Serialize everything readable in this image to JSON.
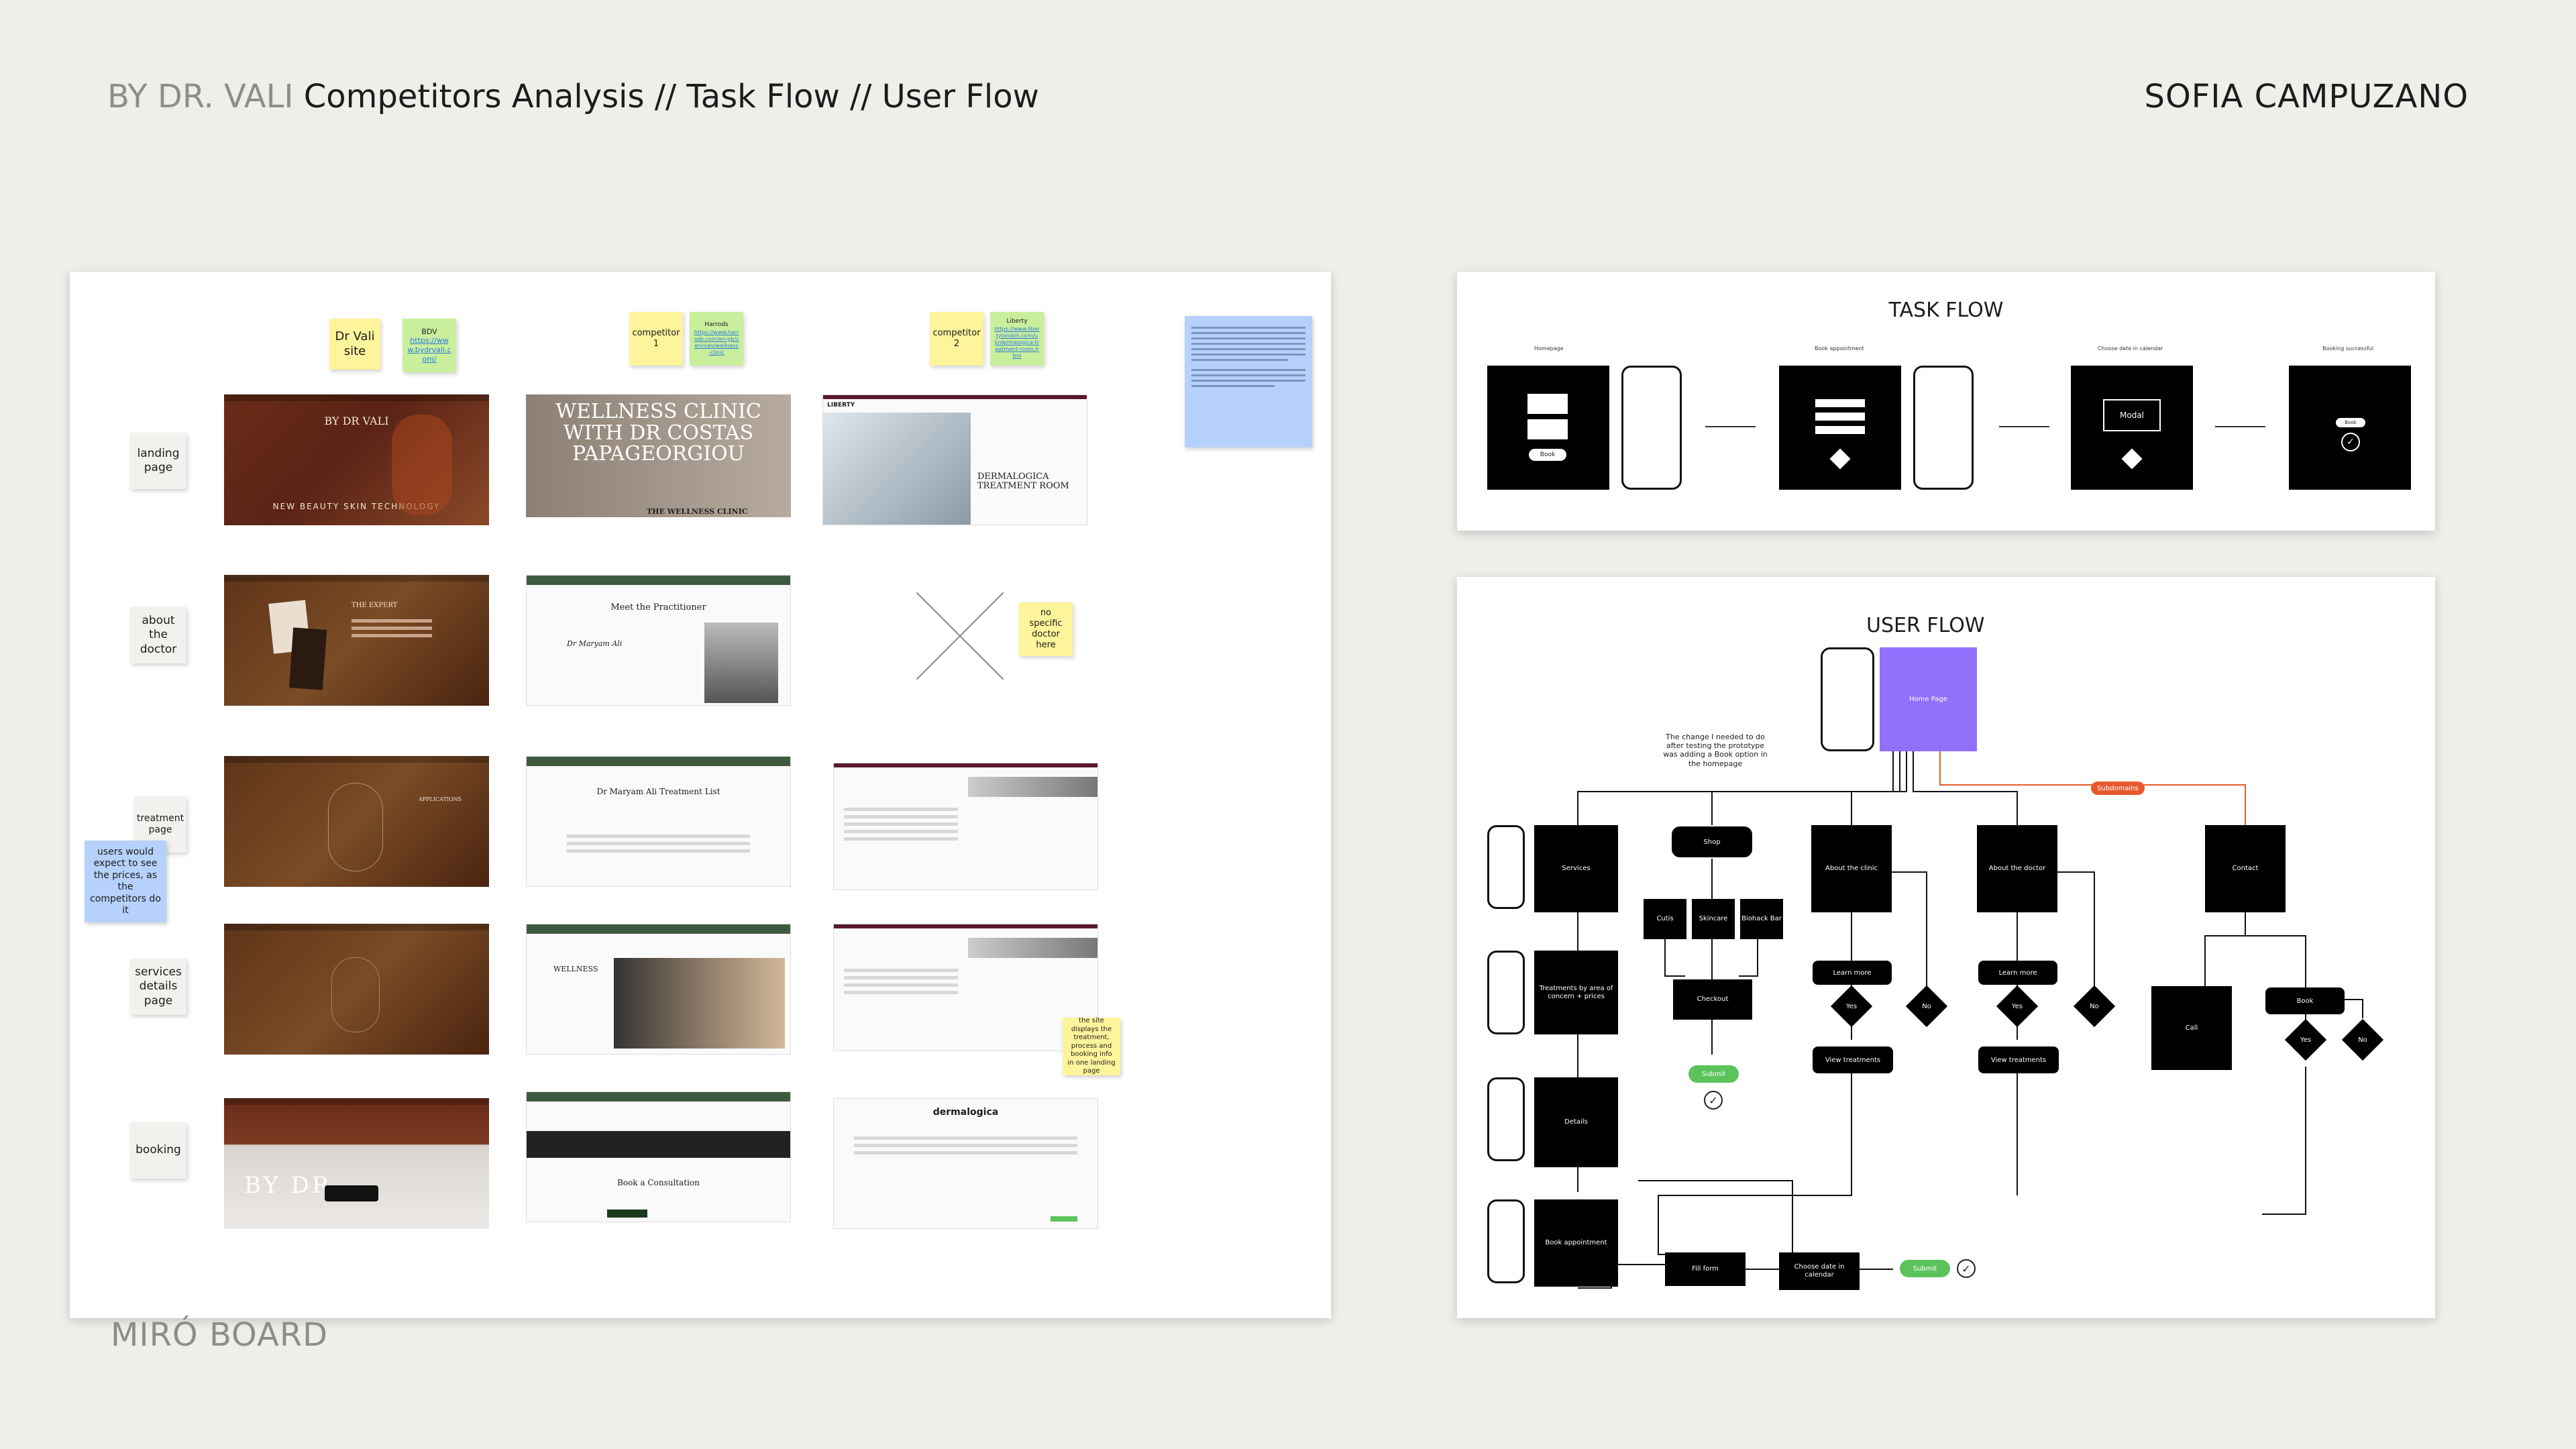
{
  "header": {
    "brand": "BY DR. VALI",
    "title": "Competitors Analysis // Task Flow // User Flow",
    "author": "SOFIA CAMPUZANO"
  },
  "board_label": "MIRÓ BOARD",
  "miro": {
    "columns": [
      {
        "sticky": "Dr Vali site",
        "link_label": "BDV",
        "link": "https://www.bydrvali.com/"
      },
      {
        "sticky": "competitor 1",
        "link_label": "Harrods",
        "link": "https://www.harrods.com/en-gb/services/wellness-clinic"
      },
      {
        "sticky": "competitor 2",
        "link_label": "Liberty",
        "link": "https://www.libertylondon.com/uk/dermalogica-treatment-room.html"
      }
    ],
    "row_labels": [
      "landing page",
      "about the doctor",
      "treatment page",
      "services details page",
      "booking"
    ],
    "notes": {
      "users_expect": "users would expect to see the prices, as the competitors do it",
      "no_doctor": "no specific doctor here",
      "site_displays": "the site displays the treatment, process and booking info in one landing page"
    },
    "thumbs": {
      "bdv_landing": "BY DR VALI",
      "bdv_landing_tag": "NEW BEAUTY SKIN TECHNOLOGY",
      "bdv_about": "THE EXPERT",
      "bdv_treatment": "APPLICATIONS",
      "bdv_booking": "BY DR",
      "h_landing": "WELLNESS CLINIC WITH DR COSTAS PAPAGEORGIOU",
      "h_landing_sub": "THE WELLNESS CLINIC",
      "h_about": "Meet the Practitioner",
      "h_about_name": "Dr Maryam Ali",
      "h_treatment": "Dr Maryam Ali Treatment List",
      "h_services": "WELLNESS",
      "h_booking": "Book a Consultation",
      "l_landing_brand": "LIBERTY",
      "l_landing": "DERMALOGICA TREATMENT ROOM",
      "l_booking": "dermalogica"
    }
  },
  "task_flow": {
    "title": "TASK FLOW",
    "steps": [
      {
        "label": "Homepage",
        "button": "Book"
      },
      {
        "label": "Book appointment",
        "button": ""
      },
      {
        "label": "Choose date in calendar",
        "button": "Modal"
      },
      {
        "label": "Booking successful",
        "button": "Book"
      }
    ]
  },
  "user_flow": {
    "title": "USER FLOW",
    "home": "Home Page",
    "note": "The change I needed to do after testing the prototype was adding a Book option in the homepage",
    "subdomains": "Subdomains",
    "services": "Services",
    "treatments": "Treatments by area of concern + prices",
    "details": "Details",
    "book_appointment": "Book appointment",
    "shop": "Shop",
    "shop_items": [
      "Cutis",
      "Skincare",
      "Biohack Bar"
    ],
    "checkout": "Checkout",
    "submit": "Submit",
    "about_clinic": "About the clinic",
    "about_doctor": "About the doctor",
    "learn_more": "Learn more",
    "yes": "Yes",
    "no": "No",
    "view_treatments": "View treatments",
    "contact": "Contact",
    "call": "Call",
    "book": "Book",
    "fill_form": "Fill form",
    "choose_date": "Choose date in calendar"
  },
  "colors": {
    "background": "#eeeeea",
    "accent_purple": "#9270fb",
    "submit_green": "#5cc35c",
    "subdomain_orange": "#e65a2e"
  }
}
